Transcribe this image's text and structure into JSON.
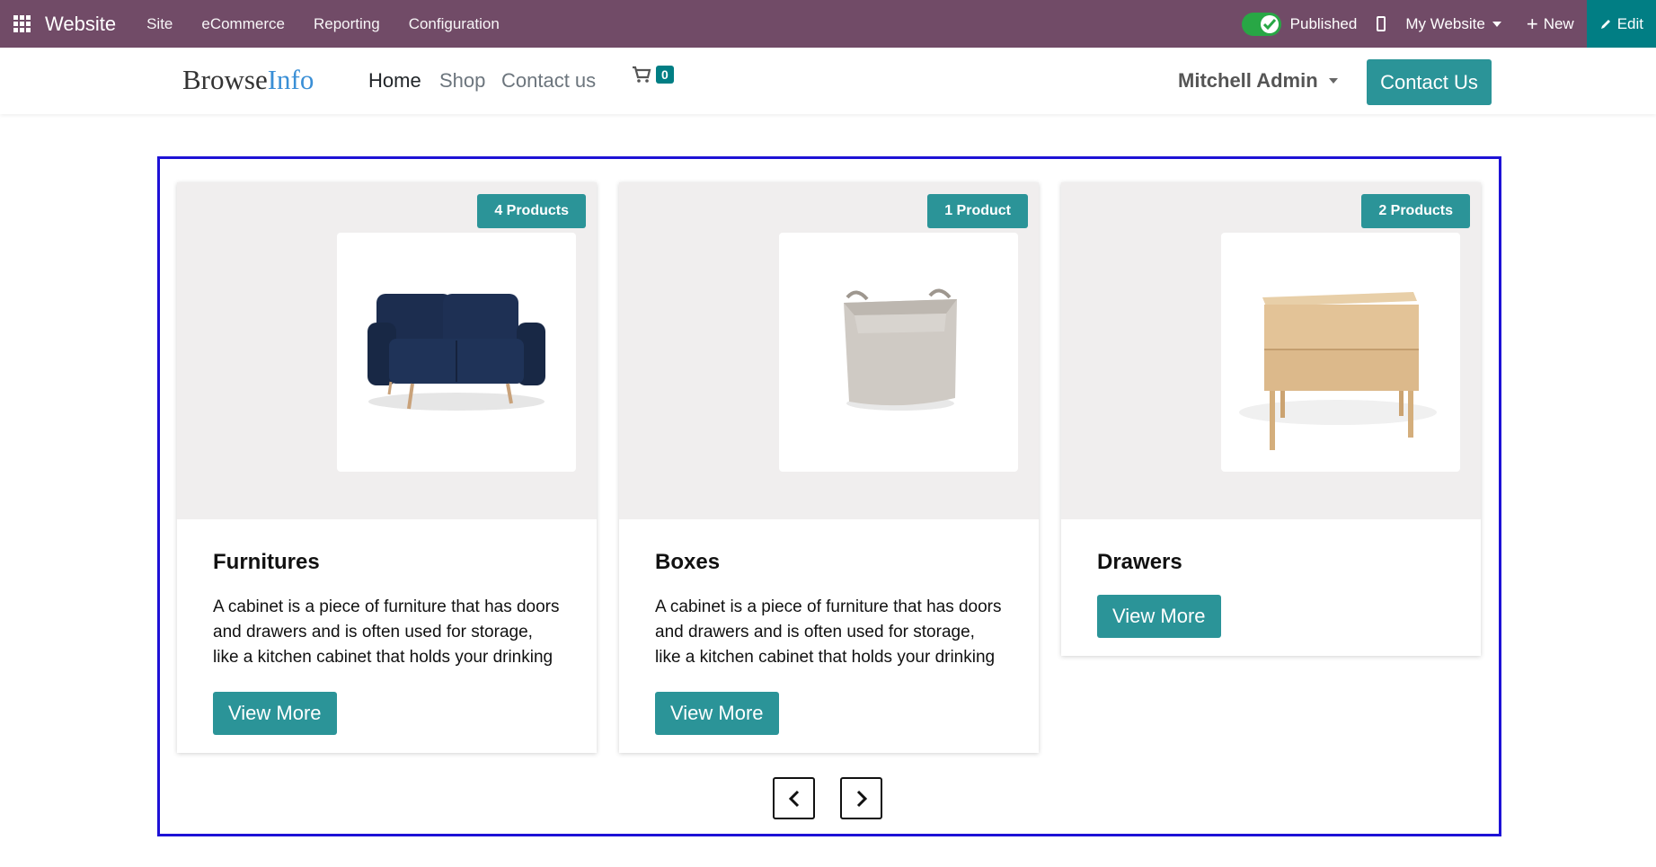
{
  "topbar": {
    "brand": "Website",
    "menus": [
      "Site",
      "eCommerce",
      "Reporting",
      "Configuration"
    ],
    "published_label": "Published",
    "website_selector": "My Website",
    "new_label": "New",
    "edit_label": "Edit",
    "colors": {
      "bar": "#714b67",
      "edit": "#017e84",
      "toggle": "#28a745"
    }
  },
  "header": {
    "logo_part1": "Browse",
    "logo_part2": "Info",
    "nav": [
      "Home",
      "Shop",
      "Contact us"
    ],
    "cart_count": "0",
    "user": "Mitchell Admin",
    "contact_button": "Contact Us",
    "accent": "#2b9498"
  },
  "categories": [
    {
      "badge": "4 Products",
      "title": "Furnitures",
      "description": "A cabinet is a piece of furniture that has doors and drawers and is often used for storage, like a kitchen cabinet that holds your drinking",
      "button": "View More",
      "image": "sofa"
    },
    {
      "badge": "1 Product",
      "title": "Boxes",
      "description": "A cabinet is a piece of furniture that has doors and drawers and is often used for storage, like a kitchen cabinet that holds your drinking",
      "button": "View More",
      "image": "fabric-basket"
    },
    {
      "badge": "2 Products",
      "title": "Drawers",
      "description": "",
      "button": "View More",
      "image": "wooden-drawer"
    }
  ],
  "carousel": {
    "prev_icon": "chevron-left-icon",
    "next_icon": "chevron-right-icon"
  }
}
